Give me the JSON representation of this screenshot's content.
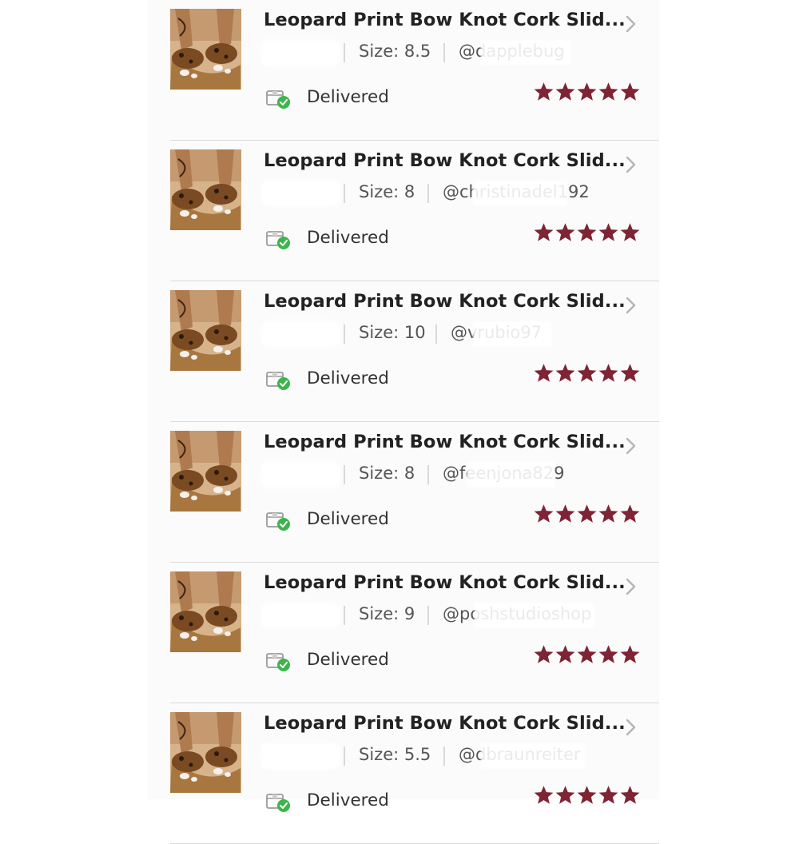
{
  "colors": {
    "star": "#7e2434",
    "delivered_check": "#3cb54a",
    "title_text": "#222222",
    "meta_text": "#555555",
    "divider": "#dcdcdc"
  },
  "icons": {
    "row_chevron": "chevron-right-icon",
    "status": "delivered-box-check-icon",
    "rating": "star-icon"
  },
  "orders": [
    {
      "title": "Leopard Print Bow Knot Cork Slid...",
      "size": "Size: 8.5",
      "username": "@dapplebug",
      "status": "Delivered",
      "rating": 5
    },
    {
      "title": "Leopard Print Bow Knot Cork Slid...",
      "size": "Size: 8",
      "username": "@christinadel192",
      "status": "Delivered",
      "rating": 5
    },
    {
      "title": "Leopard Print Bow Knot Cork Slid...",
      "size": "Size: 10",
      "username": "@vrubio97",
      "status": "Delivered",
      "rating": 5
    },
    {
      "title": "Leopard Print Bow Knot Cork Slid...",
      "size": "Size: 8",
      "username": "@feenjona829",
      "status": "Delivered",
      "rating": 5
    },
    {
      "title": "Leopard Print Bow Knot Cork Slid...",
      "size": "Size: 9",
      "username": "@poshstudioshop",
      "status": "Delivered",
      "rating": 5
    },
    {
      "title": "Leopard Print Bow Knot Cork Slid...",
      "size": "Size: 5.5",
      "username": "@dbraunreiter",
      "status": "Delivered",
      "rating": 5
    }
  ]
}
